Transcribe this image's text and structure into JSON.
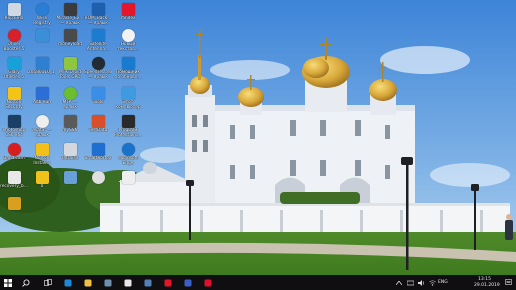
{
  "desktop_icons": [
    {
      "label": "Корзина",
      "color": "#cfd8e3"
    },
    {
      "label": "Wise Registry Cleaner",
      "color": "#2a7fd4"
    },
    {
      "label": "Miracle_Ex... — ярлык",
      "color": "#3b3b3b"
    },
    {
      "label": "ROM_Back... — ярлык",
      "color": "#1f5fb0"
    },
    {
      "label": "Yandex",
      "color": "#e4162a"
    },
    {
      "label": "Driver Booster 5",
      "color": "#d8202a"
    },
    {
      "label": "",
      "color": "#3a8fd8"
    },
    {
      "label": "moneyload",
      "color": "#4a4a4a"
    },
    {
      "label": "Satellite Antenna...",
      "color": "#1e7ccf"
    },
    {
      "label": "Новый текстов...",
      "color": "#f2f2f2"
    },
    {
      "label": "Glary Utilities 5",
      "color": "#18a0d8"
    },
    {
      "label": "20180110_1...",
      "color": "#2f7fd0"
    },
    {
      "label": "MTK Droid Tools GPD",
      "color": "#8ec63f"
    },
    {
      "label": "SpeedTest.ex — ярлык",
      "color": "#222a33"
    },
    {
      "label": "Помощник по обновл...",
      "color": "#1a7ad0"
    },
    {
      "label": "Norton Security Scan",
      "color": "#f3c317"
    },
    {
      "label": "Adb Run",
      "color": "#2b6fd6"
    },
    {
      "label": "MTK — ярлык",
      "color": "#6cbf2c"
    },
    {
      "label": "Tools",
      "color": "#3a8ee8"
    },
    {
      "label": "Этот компьютер",
      "color": "#3f9be0"
    },
    {
      "label": "Photoshop CS6 x64",
      "color": "#1b3e66"
    },
    {
      "label": "Avatar — ярлык",
      "color": "#eeeeee"
    },
    {
      "label": "mySSN",
      "color": "#5a5a5a"
    },
    {
      "label": "TestData",
      "color": "#d84f2a"
    },
    {
      "label": "ProgDVB Professiona...",
      "color": "#2a2a2a"
    },
    {
      "label": "Bandicam",
      "color": "#d81e1e"
    },
    {
      "label": "Norton Installer",
      "color": "#f2c018"
    },
    {
      "label": "Ultraiso",
      "color": "#d4d8de"
    },
    {
      "label": "SmartVortex",
      "color": "#1e6fd0"
    },
    {
      "label": "Microsoft Edge",
      "color": "#1b72c9"
    },
    {
      "label": "recovery_b...",
      "color": "#e8e8e8"
    },
    {
      "label": "0",
      "color": "#f1c21b"
    },
    {
      "label": "",
      "color": "#6aa0d8"
    },
    {
      "label": "",
      "color": "#e0e0e0"
    },
    {
      "label": "",
      "color": "#eeeeee"
    },
    {
      "label": "",
      "color": "#d9a020"
    }
  ],
  "taskbar": {
    "start_color": "#ffffff",
    "pinned": [
      {
        "name": "search",
        "color": "#ffffff"
      },
      {
        "name": "task-view",
        "color": "#ffffff"
      },
      {
        "name": "edge",
        "color": "#1b8bd9"
      },
      {
        "name": "file-explorer",
        "color": "#f0c040"
      },
      {
        "name": "store",
        "color": "#6f8fb0"
      },
      {
        "name": "mail",
        "color": "#e8e8e8"
      },
      {
        "name": "vk",
        "color": "#5181b8"
      },
      {
        "name": "yandex-browser",
        "color": "#e4162a"
      },
      {
        "name": "media",
        "color": "#3a5fc8"
      },
      {
        "name": "opera",
        "color": "#e0102c"
      }
    ],
    "tray": {
      "language": "ENG",
      "time": "13:15",
      "date": "29.01.2019"
    }
  }
}
